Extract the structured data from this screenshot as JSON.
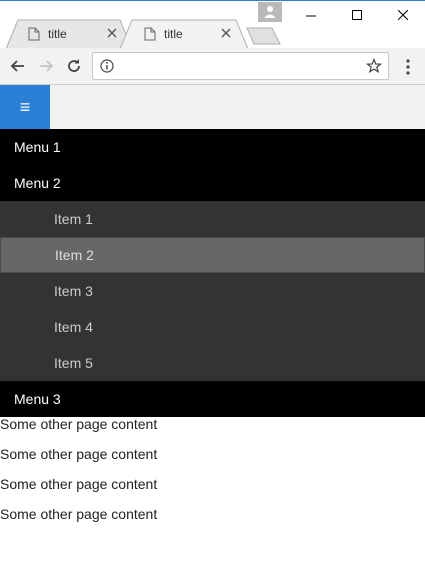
{
  "browser": {
    "tabs": [
      {
        "title": "title",
        "active": false
      },
      {
        "title": "title",
        "active": true
      }
    ],
    "address": {
      "value": ""
    },
    "colors": {
      "accent": "#2b7fd4"
    }
  },
  "header": {
    "menu_button_glyph": "≡",
    "menu_button_icon": "hamburger-icon"
  },
  "menu": {
    "items": [
      {
        "label": "Menu 1"
      },
      {
        "label": "Menu 2"
      },
      {
        "label": "Menu 3"
      }
    ],
    "submenu": {
      "parent": "Menu 2",
      "items": [
        {
          "label": "Item 1"
        },
        {
          "label": "Item 2",
          "active": true
        },
        {
          "label": "Item 3"
        },
        {
          "label": "Item 4"
        },
        {
          "label": "Item 5"
        }
      ]
    }
  },
  "content": {
    "lines": [
      "Some other page content",
      "Some other page content",
      "Some other page content",
      "Some other page content"
    ]
  }
}
